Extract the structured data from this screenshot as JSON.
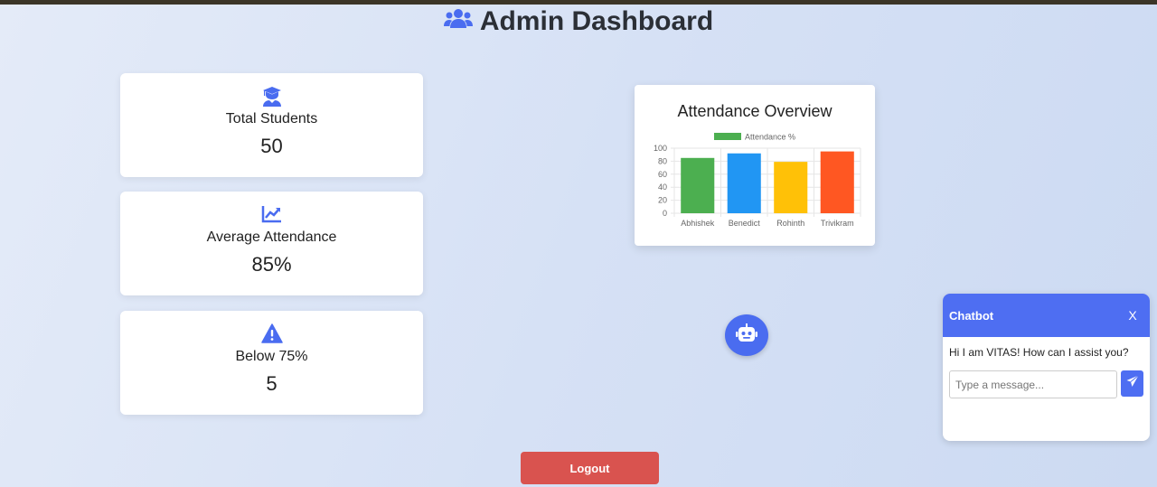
{
  "header": {
    "title": "Admin Dashboard",
    "icon": "users-icon"
  },
  "stats": [
    {
      "icon": "graduate-icon",
      "label": "Total Students",
      "value": "50"
    },
    {
      "icon": "trend-chart-icon",
      "label": "Average Attendance",
      "value": "85%"
    },
    {
      "icon": "warning-icon",
      "label": "Below 75%",
      "value": "5"
    }
  ],
  "chart_card": {
    "title": "Attendance Overview"
  },
  "chart_data": {
    "type": "bar",
    "categories": [
      "Abhishek",
      "Benedict",
      "Rohinth",
      "Trivikram"
    ],
    "series": [
      {
        "name": "Attendance %",
        "values": [
          85,
          92,
          79,
          95
        ]
      }
    ],
    "colors": [
      "#4caf50",
      "#2196f3",
      "#ffc107",
      "#ff5722"
    ],
    "legend_color": "#4caf50",
    "ylim": [
      0,
      100
    ],
    "yticks": [
      "0",
      "20",
      "40",
      "60",
      "80",
      "100"
    ]
  },
  "chatbot": {
    "title": "Chatbot",
    "close_label": "X",
    "greeting": "Hi I am VITAS! How can I assist you?",
    "input_placeholder": "Type a message...",
    "send_icon": "send-icon"
  },
  "fab": {
    "icon": "robot-icon"
  },
  "logout_label": "Logout",
  "colors": {
    "accent": "#4e6ef2",
    "logout": "#d9534f",
    "icon": "#4a6cf0"
  }
}
